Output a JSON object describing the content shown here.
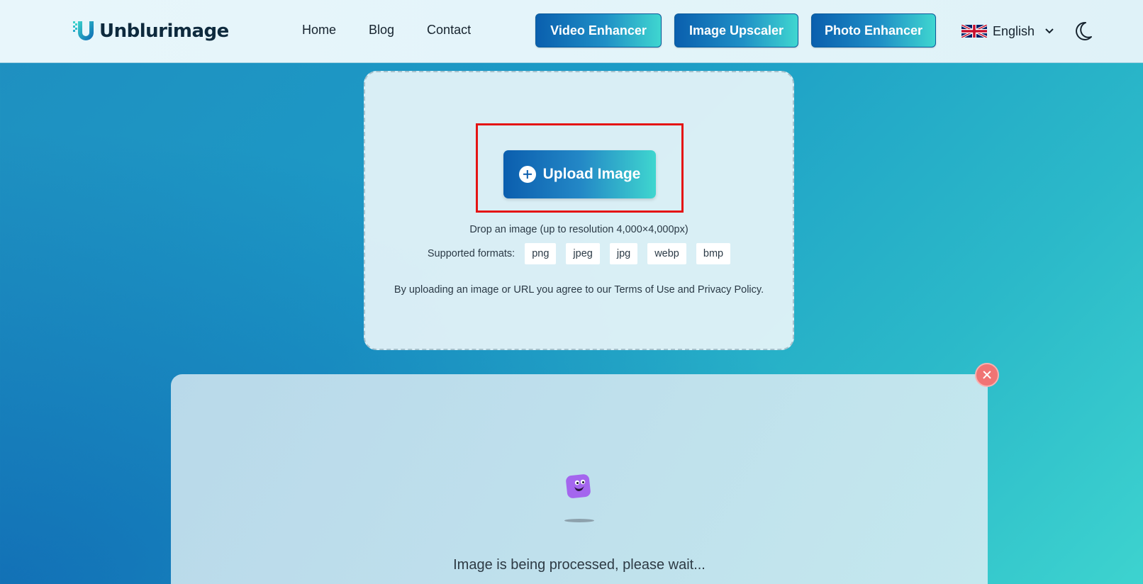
{
  "header": {
    "logo_text": "Unblurimage",
    "nav": [
      {
        "label": "Home"
      },
      {
        "label": "Blog"
      },
      {
        "label": "Contact"
      }
    ],
    "tools": {
      "video": "Video Enhancer",
      "upscaler": "Image Upscaler",
      "photo": "Photo Enhancer"
    },
    "language": "English",
    "theme_icon": "moon-icon"
  },
  "upload": {
    "button_label": "Upload Image",
    "button_icon": "plus-circle-icon",
    "drop_text": "Drop an image (up to resolution 4,000×4,000px)",
    "formats_label": "Supported formats:",
    "formats": [
      "png",
      "jpeg",
      "jpg",
      "webp",
      "bmp"
    ],
    "terms_text": "By uploading an image or URL you agree to our Terms of Use and Privacy Policy."
  },
  "processing": {
    "status_text": "Image is being processed, please wait...",
    "close_icon": "close-icon",
    "loader_icon": "purple-creature-loader-icon"
  },
  "colors": {
    "accent_start": "#0b5eae",
    "accent_end": "#3fd6cf",
    "highlight": "#e41414",
    "close": "#f07474",
    "loader": "#a466ee"
  }
}
